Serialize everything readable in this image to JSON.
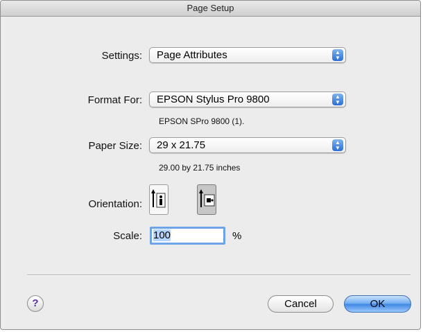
{
  "window": {
    "title": "Page Setup"
  },
  "settings": {
    "label": "Settings:",
    "value": "Page Attributes"
  },
  "format_for": {
    "label": "Format For:",
    "value": "EPSON Stylus Pro 9800",
    "detail": "EPSON SPro 9800 (1)."
  },
  "paper_size": {
    "label": "Paper Size:",
    "value": "29 x 21.75",
    "detail": "29.00 by 21.75 inches"
  },
  "orientation": {
    "label": "Orientation:",
    "options": [
      "portrait",
      "landscape"
    ],
    "selected": "landscape"
  },
  "scale": {
    "label": "Scale:",
    "value": "100",
    "unit": "%"
  },
  "buttons": {
    "help": "?",
    "cancel": "Cancel",
    "ok": "OK"
  },
  "colors": {
    "accent": "#3b86e3",
    "window_bg": "#ececec",
    "help_icon": "#5a2ea0"
  }
}
